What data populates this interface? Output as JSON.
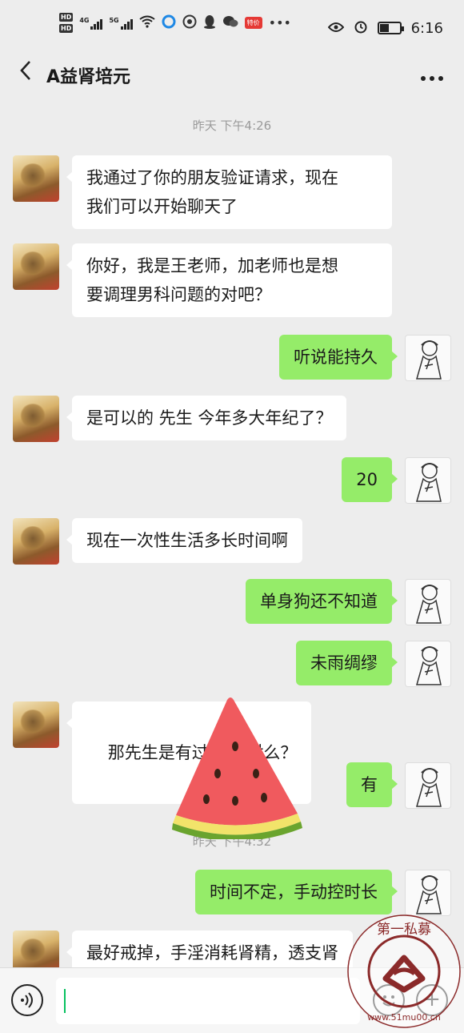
{
  "status_bar": {
    "hd_1": "HD",
    "hd_2": "HD",
    "signal_1": "4G",
    "signal_2": "5G",
    "shop_badge": "特价",
    "time": "6:16"
  },
  "header": {
    "back_glyph": "〈",
    "title": "A益肾培元",
    "more_glyph": "•••"
  },
  "timestamps": [
    "昨天 下午4:26",
    "昨天 下午4:32"
  ],
  "messages": [
    {
      "from": "in",
      "text_lines": [
        "我通过了你的朋友验证请求，现在",
        "我们可以开始聊天了"
      ]
    },
    {
      "from": "in",
      "text_lines": [
        "你好，我是王老师，加老师也是想",
        "要调理男科问题的对吧？"
      ]
    },
    {
      "from": "out",
      "text": "听说能持久"
    },
    {
      "from": "in",
      "text": "是可以的  先生 今年多大年纪了？"
    },
    {
      "from": "out",
      "text": "20"
    },
    {
      "from": "in",
      "text": "现在一次性生活多长时间啊"
    },
    {
      "from": "out",
      "text": "单身狗还不知道"
    },
    {
      "from": "out",
      "text": "未雨绸缪"
    },
    {
      "from": "in",
      "text": "那先生是有过手    对么？"
    },
    {
      "from": "out",
      "text": "有"
    },
    {
      "from": "out",
      "text": "时间不定，手动控时长"
    },
    {
      "from": "in",
      "text": "最好戒掉，手淫消耗肾精，透支肾"
    }
  ],
  "input_bar": {
    "voice_glyph": "))",
    "plus_glyph": "+",
    "input_value": ""
  },
  "icons": {
    "avatar_in": "doctor-avatar",
    "avatar_out": "sketch-man-avatar",
    "overlay": "watermelon-sticker",
    "watermark": "stamp-watermark"
  },
  "watermark": {
    "text": "第一私募",
    "url": "www.51mu00.cn"
  },
  "colors": {
    "background": "#ededed",
    "bubble_out": "#95ec69",
    "bubble_in": "#ffffff",
    "cursor": "#07c160",
    "stamp": "#8b2a2a"
  }
}
